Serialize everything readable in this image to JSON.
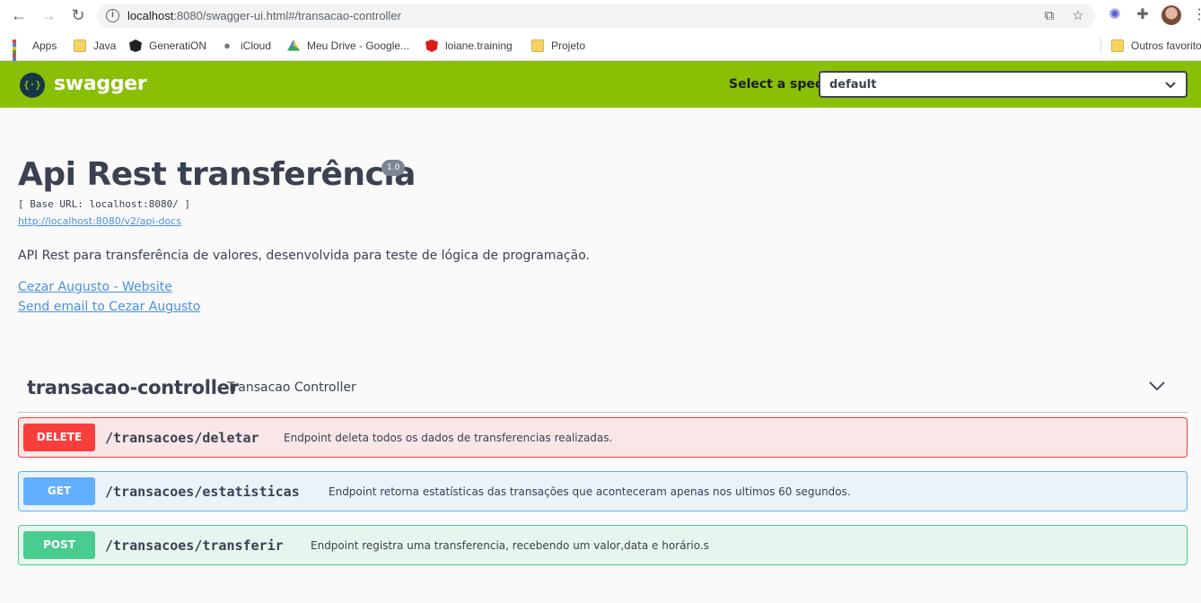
{
  "browser": {
    "url_host": "localhost",
    "url_rest": ":8080/swagger-ui.html#/transacao-controller",
    "bookmarks": [
      {
        "label": "Apps"
      },
      {
        "label": "Java"
      },
      {
        "label": "GeneratiON"
      },
      {
        "label": "iCloud"
      },
      {
        "label": "Meu Drive - Google..."
      },
      {
        "label": "loiane.training"
      },
      {
        "label": "Projeto"
      },
      {
        "label": "Outros favoritos"
      }
    ]
  },
  "topbar": {
    "logo_text": "swagger",
    "spec_label": "Select a spec",
    "spec_value": "default"
  },
  "info": {
    "title": "Api Rest transferência",
    "version": "1.0",
    "base_url": "[ Base URL: localhost:8080/ ]",
    "api_docs_link": "http://localhost:8080/v2/api-docs",
    "description": "API Rest para transferência de valores, desenvolvida para teste de lógica de programação.",
    "contact_website": "Cezar Augusto - Website",
    "contact_email": "Send email to Cezar Augusto"
  },
  "tag": {
    "name": "transacao-controller",
    "description": "Transacao Controller"
  },
  "operations": [
    {
      "method": "DELETE",
      "path": "/transacoes/deletar",
      "summary": "Endpoint deleta todos os dados de transferencias realizadas.",
      "color": "#f93e3e"
    },
    {
      "method": "GET",
      "path": "/transacoes/estatisticas",
      "summary": "Endpoint retorna estatísticas das transações que aconteceram apenas nos ultimos 60 segundos.",
      "color": "#61affe"
    },
    {
      "method": "POST",
      "path": "/transacoes/transferir",
      "summary": "Endpoint registra uma transferencia, recebendo um valor,data e horário.s",
      "color": "#49cc90"
    }
  ]
}
